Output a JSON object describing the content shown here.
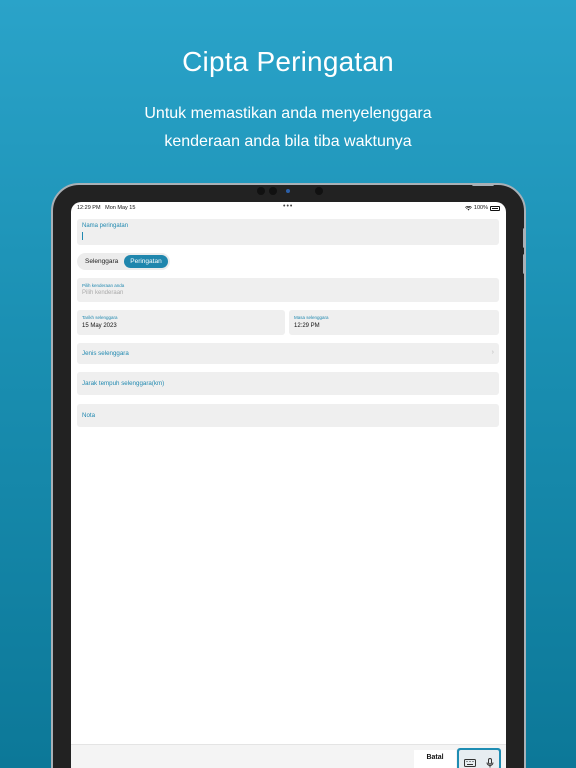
{
  "promo": {
    "title": "Cipta Peringatan",
    "subtitle_line1": "Untuk memastikan anda menyelenggara",
    "subtitle_line2": "kenderaan anda bila tiba waktunya"
  },
  "statusbar": {
    "time": "12:29 PM",
    "date": "Mon May 15",
    "battery": "100%",
    "dots": "•••"
  },
  "form": {
    "nama": {
      "label": "Nama peringatan",
      "value": ""
    },
    "segments": [
      {
        "label": "Selenggara",
        "active": false
      },
      {
        "label": "Peringatan",
        "active": true
      }
    ],
    "kenderaan": {
      "label": "Pilih kenderaan anda",
      "placeholder": "Pilih kenderaan"
    },
    "tarikh": {
      "label": "Tarikh selenggara",
      "value": "15 May 2023"
    },
    "masa": {
      "label": "Masa selenggara",
      "value": "12:29 PM"
    },
    "jenis": {
      "label": "Jenis selenggara",
      "chevron": "›"
    },
    "jarak": {
      "label": "Jarak tempuh selenggara(km)"
    },
    "nota": {
      "label": "Nota"
    }
  },
  "bottombar": {
    "cancel_label": "Batal",
    "icons": [
      "keyboard-icon",
      "microphone-icon"
    ]
  },
  "colors": {
    "accent": "#1f86ad",
    "background_top": "#2aa3c9",
    "background_bottom": "#0c7898"
  }
}
